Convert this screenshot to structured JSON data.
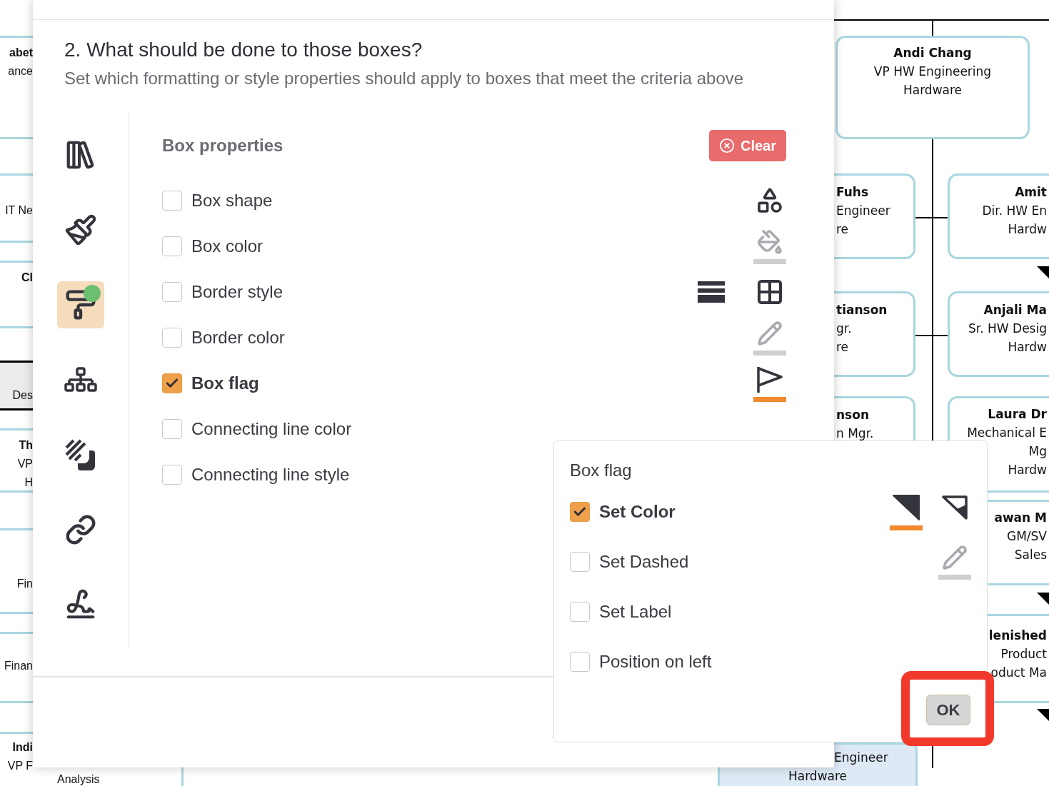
{
  "org_chart": {
    "left_nodes": [
      {
        "kind": "box",
        "title": "abet",
        "lines": [
          "ance"
        ]
      },
      {
        "kind": "box",
        "lines": [
          "IT Ne"
        ]
      },
      {
        "kind": "box",
        "title": "Cl"
      },
      {
        "kind": "header",
        "lines": [
          "Des"
        ]
      },
      {
        "kind": "box",
        "title": "Th",
        "lines": [
          "VP",
          "H"
        ]
      },
      {
        "kind": "box",
        "lines": [
          "Fin"
        ]
      },
      {
        "kind": "box",
        "lines": [
          "Finan"
        ]
      },
      {
        "kind": "box",
        "title": "Indi",
        "lines": [
          "VP F"
        ]
      }
    ],
    "bottom_left_text": "Analysis",
    "nodes": [
      {
        "title": "Andi Chang",
        "lines": [
          "VP HW Engineering",
          "Hardware"
        ]
      },
      {
        "title": "Fuhs",
        "lines": [
          "Engineer",
          "re"
        ]
      },
      {
        "title": "tianson",
        "lines": [
          "gr.",
          "re"
        ]
      },
      {
        "title": "nson",
        "lines": [
          "n Mgr."
        ]
      },
      {
        "title": "Amit",
        "lines": [
          "Dir. HW En",
          "Hardw"
        ]
      },
      {
        "title": "Anjali Ma",
        "lines": [
          "Sr. HW Desig",
          "Hardw"
        ]
      },
      {
        "title": "Laura Dr",
        "lines": [
          "Mechanical E",
          "Mg",
          "Hardw"
        ]
      },
      {
        "title": "awan M",
        "lines": [
          "GM/SV",
          "Sales"
        ]
      },
      {
        "title": "lenished",
        "lines": [
          "Product",
          "oduct Ma"
        ]
      }
    ],
    "bottom_node": {
      "highlighted": true,
      "lines": [
        "Engineer",
        "Hardware"
      ]
    }
  },
  "dialog": {
    "heading": "2. What should be done to those boxes?",
    "description": "Set which formatting or style properties should apply to boxes that meet the criteria above",
    "sidebar": {
      "items": [
        {
          "selected": false,
          "badge": false
        },
        {
          "selected": false,
          "badge": false
        },
        {
          "selected": true,
          "badge": true
        },
        {
          "selected": false,
          "badge": false
        },
        {
          "selected": false,
          "badge": false
        },
        {
          "selected": false,
          "badge": false
        },
        {
          "selected": false,
          "badge": false
        }
      ]
    },
    "section_title": "Box properties",
    "clear_button": "Clear",
    "properties": [
      {
        "label": "Box shape",
        "checked": false
      },
      {
        "label": "Box color",
        "checked": false
      },
      {
        "label": "Border style",
        "checked": false
      },
      {
        "label": "Border color",
        "checked": false
      },
      {
        "label": "Box flag",
        "checked": true
      },
      {
        "label": "Connecting line color",
        "checked": false
      },
      {
        "label": "Connecting line style",
        "checked": false
      }
    ]
  },
  "box_flag_popup": {
    "title": "Box flag",
    "options": [
      {
        "label": "Set Color",
        "checked": true
      },
      {
        "label": "Set Dashed",
        "checked": false
      },
      {
        "label": "Set Label",
        "checked": false
      },
      {
        "label": "Position on left",
        "checked": false
      }
    ],
    "ok_button": "OK"
  }
}
